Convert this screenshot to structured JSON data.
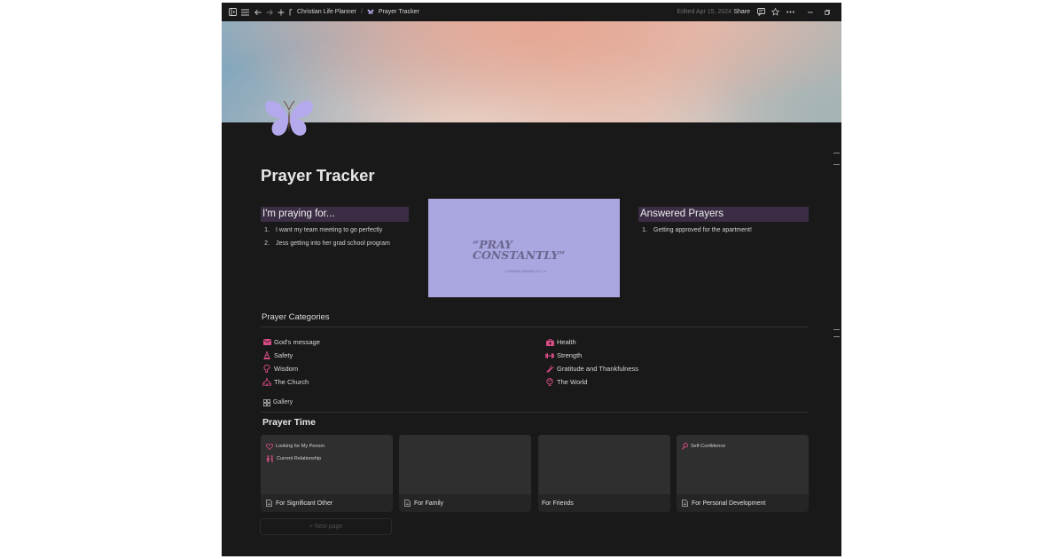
{
  "topbar": {
    "breadcrumb_parent": "Christian Life Planner",
    "breadcrumb_separator": "/",
    "breadcrumb_current": "Prayer Tracker",
    "edited": "Edited Apr 15, 2024",
    "share": "Share"
  },
  "page": {
    "title": "Prayer Tracker",
    "icon": "butterfly-icon"
  },
  "praying_for": {
    "heading": "I'm praying for...",
    "items": [
      {
        "num": "1.",
        "text": "I want my team meeting to go perfectly"
      },
      {
        "num": "2.",
        "text": "Jess getting into her grad school program"
      }
    ]
  },
  "quote": {
    "text": "“PRAY\nCONSTANTLY”",
    "ref": "1 THESSALONIANS 5:17 ➔"
  },
  "answered": {
    "heading": "Answered Prayers",
    "items": [
      {
        "num": "1.",
        "text": "Getting approved for the apartment!"
      }
    ]
  },
  "categories": {
    "heading": "Prayer Categories",
    "left": [
      {
        "label": "God's message",
        "icon": "envelope-icon"
      },
      {
        "label": "Safety",
        "icon": "cone-icon"
      },
      {
        "label": "Wisdom",
        "icon": "brain-icon"
      },
      {
        "label": "The Church",
        "icon": "church-icon"
      }
    ],
    "right": [
      {
        "label": "Health",
        "icon": "medkit-icon"
      },
      {
        "label": "Strength",
        "icon": "dumbbell-icon"
      },
      {
        "label": "Gratitude and Thankfulness",
        "icon": "praise-icon"
      },
      {
        "label": "The World",
        "icon": "globe-icon"
      }
    ]
  },
  "gallery": {
    "view_label": "Gallery",
    "heading": "Prayer Time",
    "cards": [
      {
        "title": "For Significant Other",
        "tags": [
          "Looking for My Person",
          "Current Relationship"
        ]
      },
      {
        "title": "For Family",
        "tags": []
      },
      {
        "title": "For Friends",
        "tags": []
      },
      {
        "title": "For Personal Development",
        "tags": [
          "Self-Confidence"
        ]
      }
    ],
    "new_page": "+ New page"
  },
  "colors": {
    "background": "#191919",
    "header_highlight": "#3a2d44",
    "quote_card": "#a9a6e0",
    "icon_accent": "#d84c86",
    "butterfly": "#b3a9ec"
  }
}
